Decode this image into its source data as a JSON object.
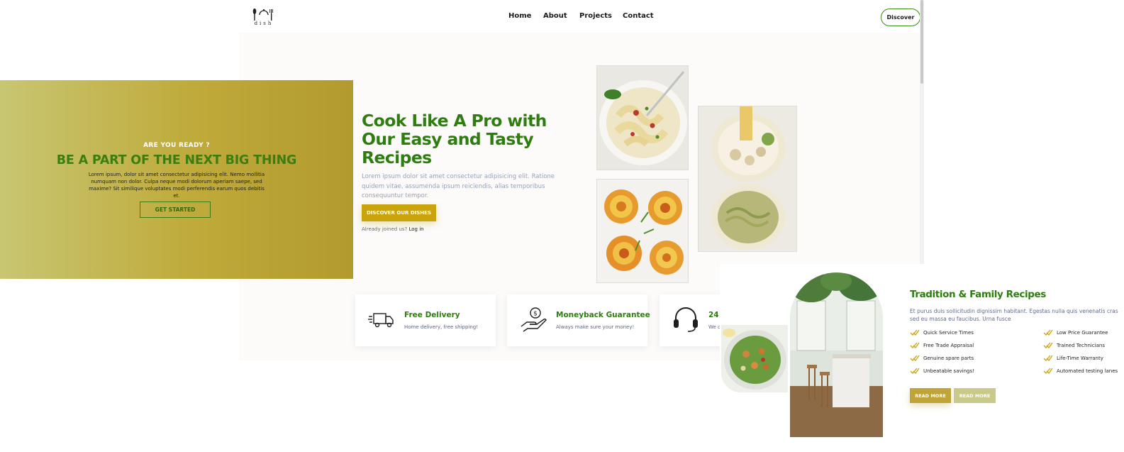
{
  "brand": {
    "logo_text": "dish"
  },
  "nav": {
    "links": [
      "Home",
      "About",
      "Projects",
      "Contact"
    ],
    "cta": "Discover"
  },
  "cta_panel": {
    "kicker": "ARE YOU READY ?",
    "title": "BE A PART OF THE NEXT BIG THING",
    "text": "Lorem ipsum, dolor sit amet consectetur adipisicing elit. Nemo mollitia numquam non dolor. Culpa neque modi dolorum aperiam saepe, sed maxime? Sit similique voluptates modi perferendis earum quos debitis et.",
    "button": "GET STARTED"
  },
  "hero": {
    "title": "Cook Like A Pro with Our Easy and Tasty Recipes",
    "text": "Lorem ipsum dolor sit amet consectetur adipisicing elit. Ratione quidem vitae, assumenda ipsum reiciendis, alias temporibus consequuntur tempor.",
    "button": "DISCOVER OUR DISHES",
    "joined_prefix": "Already joined us?",
    "login": "Log in"
  },
  "features": [
    {
      "title": "Free Delivery",
      "sub": "Home delivery, free shipping!",
      "icon": "delivery-truck-icon"
    },
    {
      "title": "Moneyback Guarantee",
      "sub": "Always make sure your money!",
      "icon": "money-hand-icon"
    },
    {
      "title": "24",
      "sub": "We c",
      "icon": "headset-icon"
    }
  ],
  "about": {
    "title": "Tradition & Family Recipes",
    "text": "Et purus duis sollicitudin dignissim habitant. Egestas nulla quis venenatis cras sed eu massa eu faucibus. Urna fusce",
    "checks_left": [
      "Quick Service Times",
      "Free Trade Appraisal",
      "Genuine spare parts",
      "Unbeatable savings!"
    ],
    "checks_right": [
      "Low Price Guarantee",
      "Trained Technicians",
      "Life-Time Warranty",
      "Automated testing lanes"
    ],
    "button_primary": "READ MORE",
    "button_secondary": "READ MORE"
  },
  "colors": {
    "brand_green": "#2e7d0f",
    "gold": "#c9a40c",
    "muted_gold": "#bfaa3a"
  }
}
